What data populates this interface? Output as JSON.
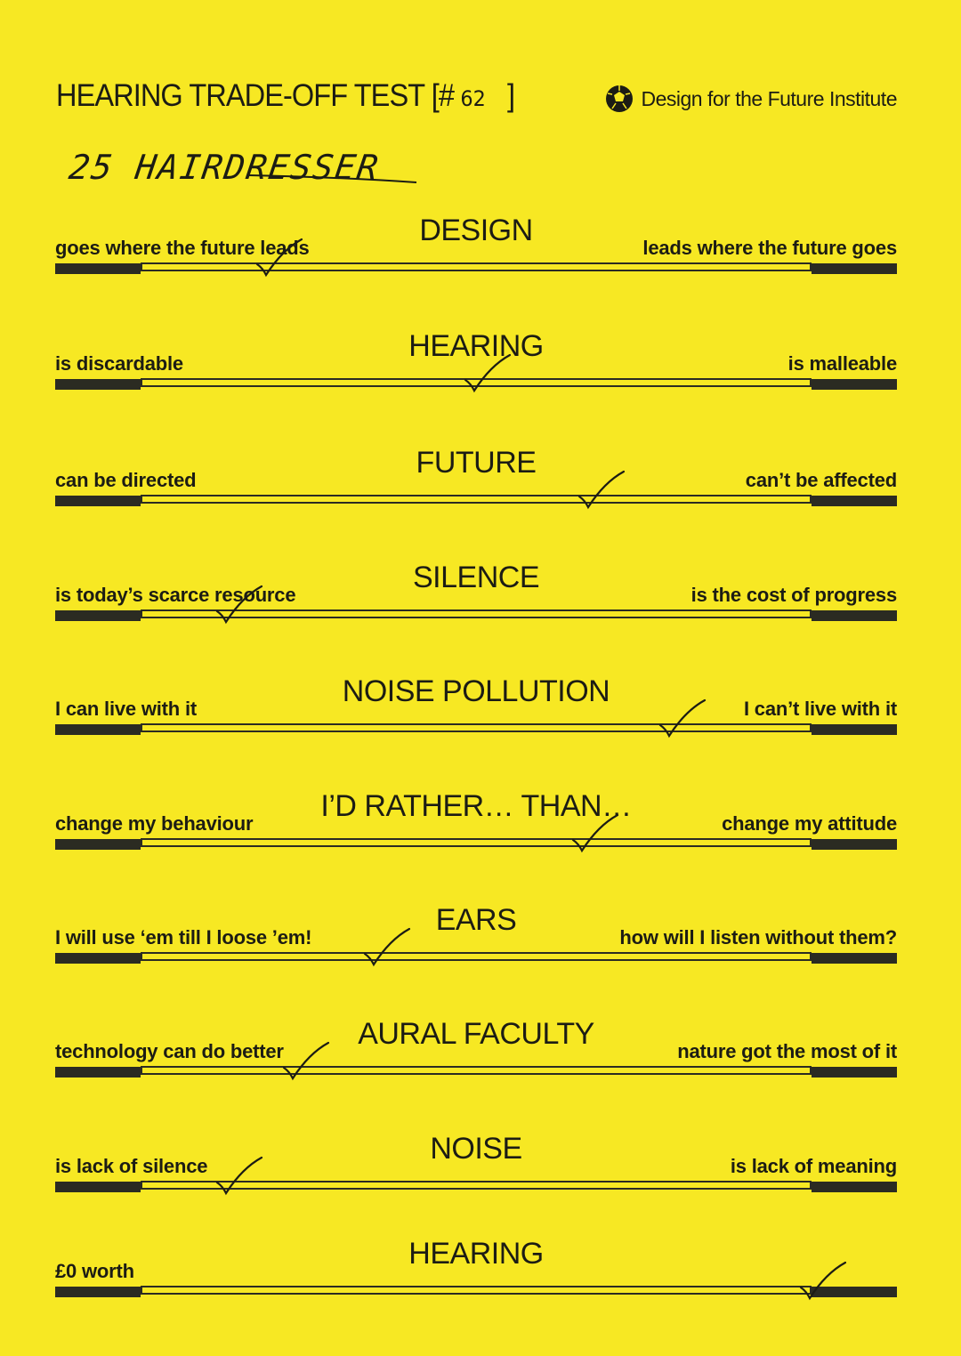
{
  "header": {
    "title": "HEARING TRADE-OFF TEST [#",
    "number": "62",
    "close": "]",
    "institute": "Design for the Future Institute"
  },
  "respondent": "25 HAIRDRESSER",
  "scales": [
    {
      "topic": "DESIGN",
      "left": "goes where the future leads",
      "right": "leads where the future goes",
      "answer": 0.19
    },
    {
      "topic": "HEARING",
      "left": "is discardable",
      "right": "is malleable",
      "answer": 0.5
    },
    {
      "topic": "FUTURE",
      "left": "can be directed",
      "right": "can’t be affected",
      "answer": 0.67
    },
    {
      "topic": "SILENCE",
      "left": "is today’s scarce resource",
      "right": "is the cost of progress",
      "answer": 0.13
    },
    {
      "topic": "NOISE POLLUTION",
      "left": "I can live with it",
      "right": "I can’t live with it",
      "answer": 0.79
    },
    {
      "topic": "I’D RATHER… THAN…",
      "left": "change my behaviour",
      "right": "change my attitude",
      "answer": 0.66
    },
    {
      "topic": "EARS",
      "left": "I will use ‘em till I loose ’em!",
      "right": "how will I listen without them?",
      "answer": 0.35
    },
    {
      "topic": "AURAL FACULTY",
      "left": "technology can do better",
      "right": "nature got the most of it",
      "answer": 0.23
    },
    {
      "topic": "NOISE",
      "left": "is lack of silence",
      "right": "is lack of meaning",
      "answer": 0.13
    },
    {
      "topic": "HEARING",
      "left": "£0 worth",
      "right": "",
      "answer": 1.0
    }
  ],
  "colors": {
    "paper": "#f7e823",
    "ink": "#1c1c14"
  }
}
